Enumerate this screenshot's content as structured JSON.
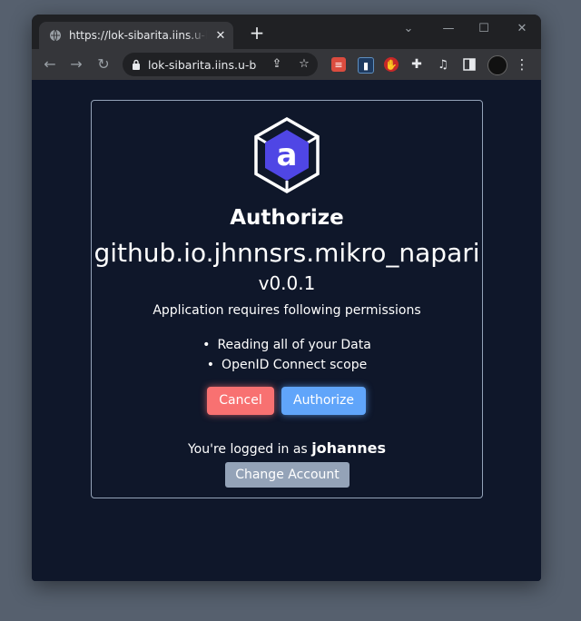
{
  "browser": {
    "tab_title": "https://lok-sibarita.iins.u-bordeaux.fr",
    "tab_close": "✕",
    "new_tab": "+",
    "url": "lok-sibarita.iins.u-b...",
    "window_controls": {
      "minimize": "—",
      "maximize": "☐",
      "close": "✕"
    },
    "extensions": [
      "todoist-icon",
      "device-icon",
      "block-icon",
      "puzzle-icon",
      "playlist-icon",
      "sidebar-icon",
      "avatar"
    ]
  },
  "auth": {
    "logo_letter": "a",
    "heading": "Authorize",
    "app_name": "github.io.jhnnsrs.mikro_napari",
    "version": "v0.0.1",
    "requires_text": "Application requires following permissions",
    "permissions": [
      "Reading all of your Data",
      "OpenID Connect scope"
    ],
    "cancel_label": "Cancel",
    "authorize_label": "Authorize",
    "logged_in_prefix": "You're logged in as",
    "username": "johannes",
    "change_account_label": "Change Account"
  },
  "colors": {
    "page_bg": "#0f172a",
    "cancel": "#f87171",
    "authorize": "#60a5fa",
    "change_account": "#94a3b8",
    "logo_fill": "#4f46e5"
  }
}
